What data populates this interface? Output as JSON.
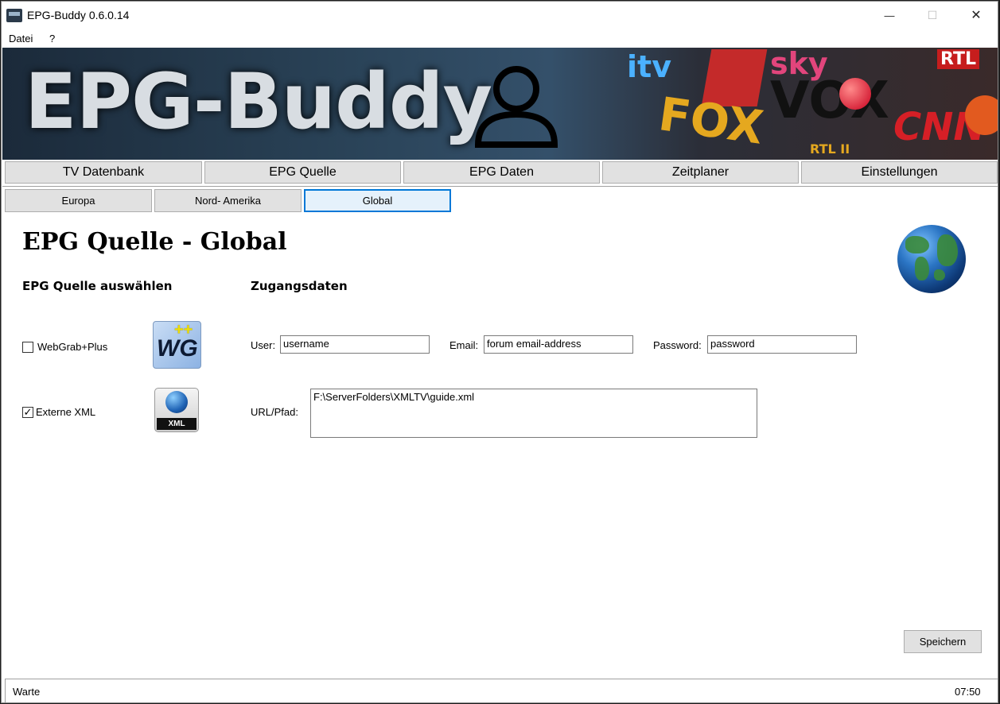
{
  "window": {
    "title": "EPG-Buddy 0.6.0.14",
    "minimize": "—",
    "maximize": "☐",
    "close": "✕"
  },
  "menu": {
    "items": [
      {
        "label": "Datei"
      },
      {
        "label": "?"
      }
    ]
  },
  "banner": {
    "title": "EPG-Buddy",
    "logos": {
      "itv": "itv",
      "sky": "sky",
      "rtl": "RTL",
      "fox": "FOX",
      "vox": "VOX",
      "rtl2": "RTL II",
      "cnn": "CNN"
    }
  },
  "tabs_main": [
    {
      "label": "TV Datenbank"
    },
    {
      "label": "EPG Quelle"
    },
    {
      "label": "EPG Daten"
    },
    {
      "label": "Zeitplaner"
    },
    {
      "label": "Einstellungen"
    }
  ],
  "tabs_sub": [
    {
      "label": "Europa"
    },
    {
      "label": "Nord- Amerika"
    },
    {
      "label": "Global",
      "active": true
    }
  ],
  "page": {
    "title": "EPG Quelle - Global",
    "source_section": "EPG Quelle auswählen",
    "credentials_section": "Zugangsdaten"
  },
  "sources": {
    "webgrab": {
      "label": "WebGrab+Plus",
      "checked": false,
      "logo_text": "WG",
      "logo_plus": "++"
    },
    "xml": {
      "label": "Externe XML",
      "checked": true,
      "logo_text": "XML"
    }
  },
  "credentials": {
    "user_label": "User:",
    "user_value": "username",
    "email_label": "Email:",
    "email_value": "forum email-address",
    "password_label": "Password:",
    "password_value": "password",
    "url_label": "URL/Pfad:",
    "url_value": "F:\\ServerFolders\\XMLTV\\guide.xml"
  },
  "actions": {
    "save": "Speichern"
  },
  "status": {
    "text": "Warte",
    "time": "07:50"
  },
  "colors": {
    "active_tab_border": "#0078d7",
    "button_bg": "#e1e1e1"
  },
  "icons": {
    "checkbox_check": "✓"
  }
}
